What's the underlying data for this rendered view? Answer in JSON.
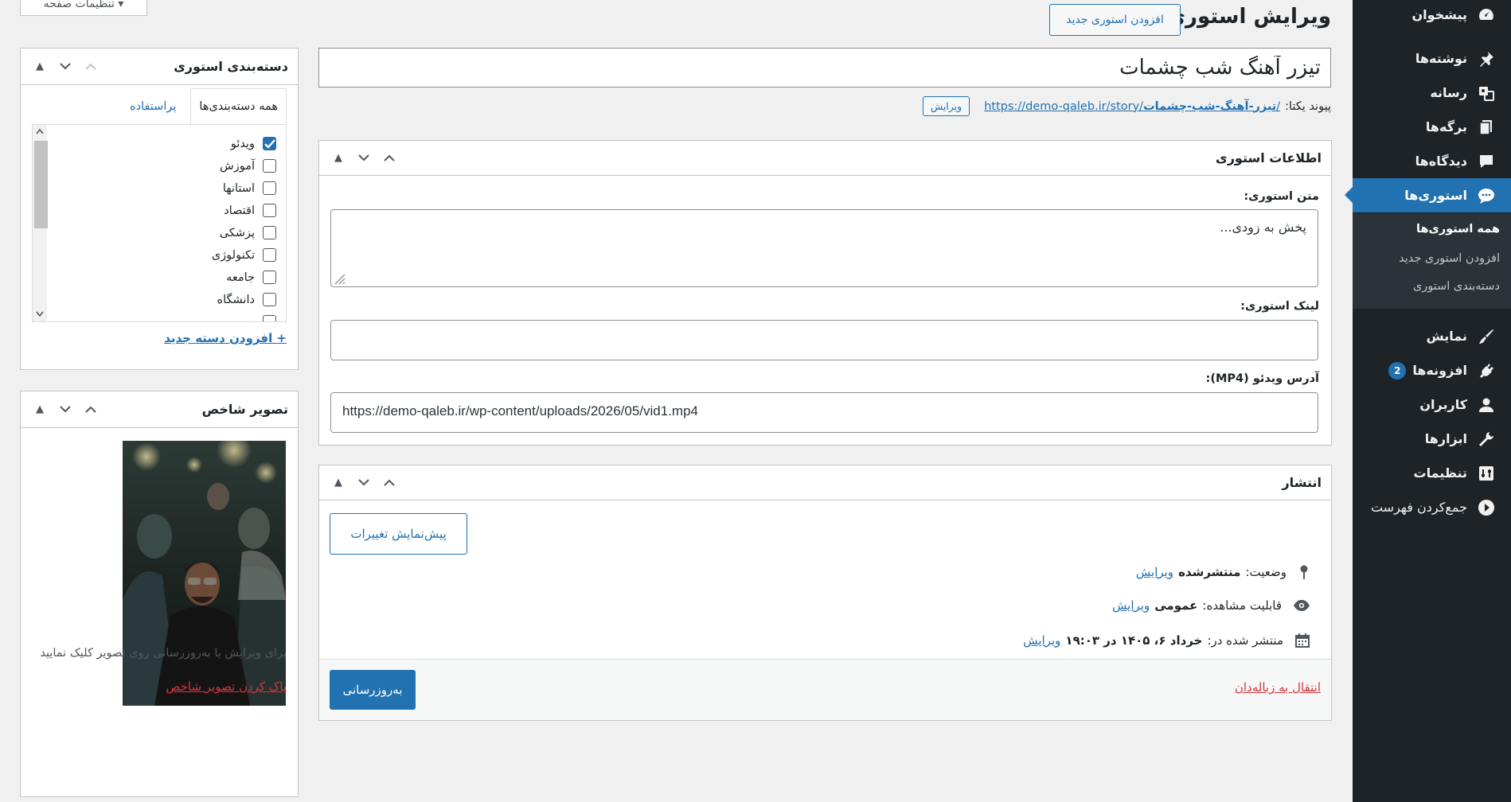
{
  "header": {
    "title": "ویرایش استوری",
    "add_new": "افزودن استوری جدید",
    "screen_options": "تنظیمات صفحه ▾"
  },
  "post": {
    "title": "تیزر آهنگ شب چشمات",
    "permalink_label": "پیوند یکتا:",
    "permalink_base": "https://demo-qaleb.ir/story/",
    "permalink_slug": "تیزر-آهنگ-شب-چشمات",
    "permalink_trail": "/",
    "permalink_edit": "ویرایش"
  },
  "story_info": {
    "title": "اطلاعات استوری",
    "text_label": "متن استوری:",
    "text_value": "پخش به زودی...",
    "link_label": "لینک استوری:",
    "link_value": "",
    "video_label": "آدرس ویدئو (MP4):",
    "video_value": "https://demo-qaleb.ir/wp-content/uploads/2026/05/vid1.mp4"
  },
  "publish": {
    "title": "انتشار",
    "preview": "پیش‌نمایش تغییرات",
    "status_label": "وضعیت:",
    "status_value": "منتشرشده",
    "visibility_label": "قابلیت مشاهده:",
    "visibility_value": "عمومی",
    "published_label": "منتشر شده در:",
    "published_value": "خرداد ۶، ۱۴۰۵ در ۱۹:۰۳",
    "edit": "ویرایش",
    "trash": "انتقال به زباله‌دان",
    "update": "به‌روزرسانی"
  },
  "categories": {
    "title": "دسته‌بندی استوری",
    "tab_all": "همه دسته‌بندی‌ها",
    "tab_popular": "پراستفاده",
    "items": [
      {
        "label": "ویدئو",
        "checked": true
      },
      {
        "label": "آموزش",
        "checked": false
      },
      {
        "label": "استانها",
        "checked": false
      },
      {
        "label": "اقتصاد",
        "checked": false
      },
      {
        "label": "پزشکی",
        "checked": false
      },
      {
        "label": "تکنولوژی",
        "checked": false
      },
      {
        "label": "جامعه",
        "checked": false
      },
      {
        "label": "دانشگاه",
        "checked": false
      }
    ],
    "add_new": "+ افزودن دسته جدید"
  },
  "featured": {
    "title": "تصویر شاخص",
    "hint": "برای ویرایش یا به‌روزرسانی روی تصویر کلیک نمایید",
    "remove": "پاک کردن تصویر شاخص"
  },
  "menu": {
    "items": [
      {
        "label": "پیشخوان",
        "icon": "dashboard-icon"
      },
      {
        "label": "نوشته‌ها",
        "icon": "pin-icon"
      },
      {
        "label": "رسانه",
        "icon": "media-icon"
      },
      {
        "label": "برگه‌ها",
        "icon": "pages-icon"
      },
      {
        "label": "دیدگاه‌ها",
        "icon": "comment-icon"
      },
      {
        "label": "استوری‌ها",
        "icon": "chat-icon",
        "active": true
      },
      {
        "label": "نمایش",
        "icon": "brush-icon"
      },
      {
        "label": "افزونه‌ها",
        "icon": "plugin-icon",
        "badge": "2"
      },
      {
        "label": "کاربران",
        "icon": "user-icon"
      },
      {
        "label": "ابزارها",
        "icon": "wrench-icon"
      },
      {
        "label": "تنظیمات",
        "icon": "settings-icon"
      },
      {
        "label": "جمع‌کردن فهرست",
        "icon": "collapse-icon"
      }
    ],
    "submenu": [
      "همه استوری‌ها",
      "افزودن استوری جدید",
      "دسته‌بندی استوری"
    ]
  },
  "colors": {
    "accent": "#2271b1",
    "sidebar": "#1d2327",
    "danger": "#d63638"
  }
}
